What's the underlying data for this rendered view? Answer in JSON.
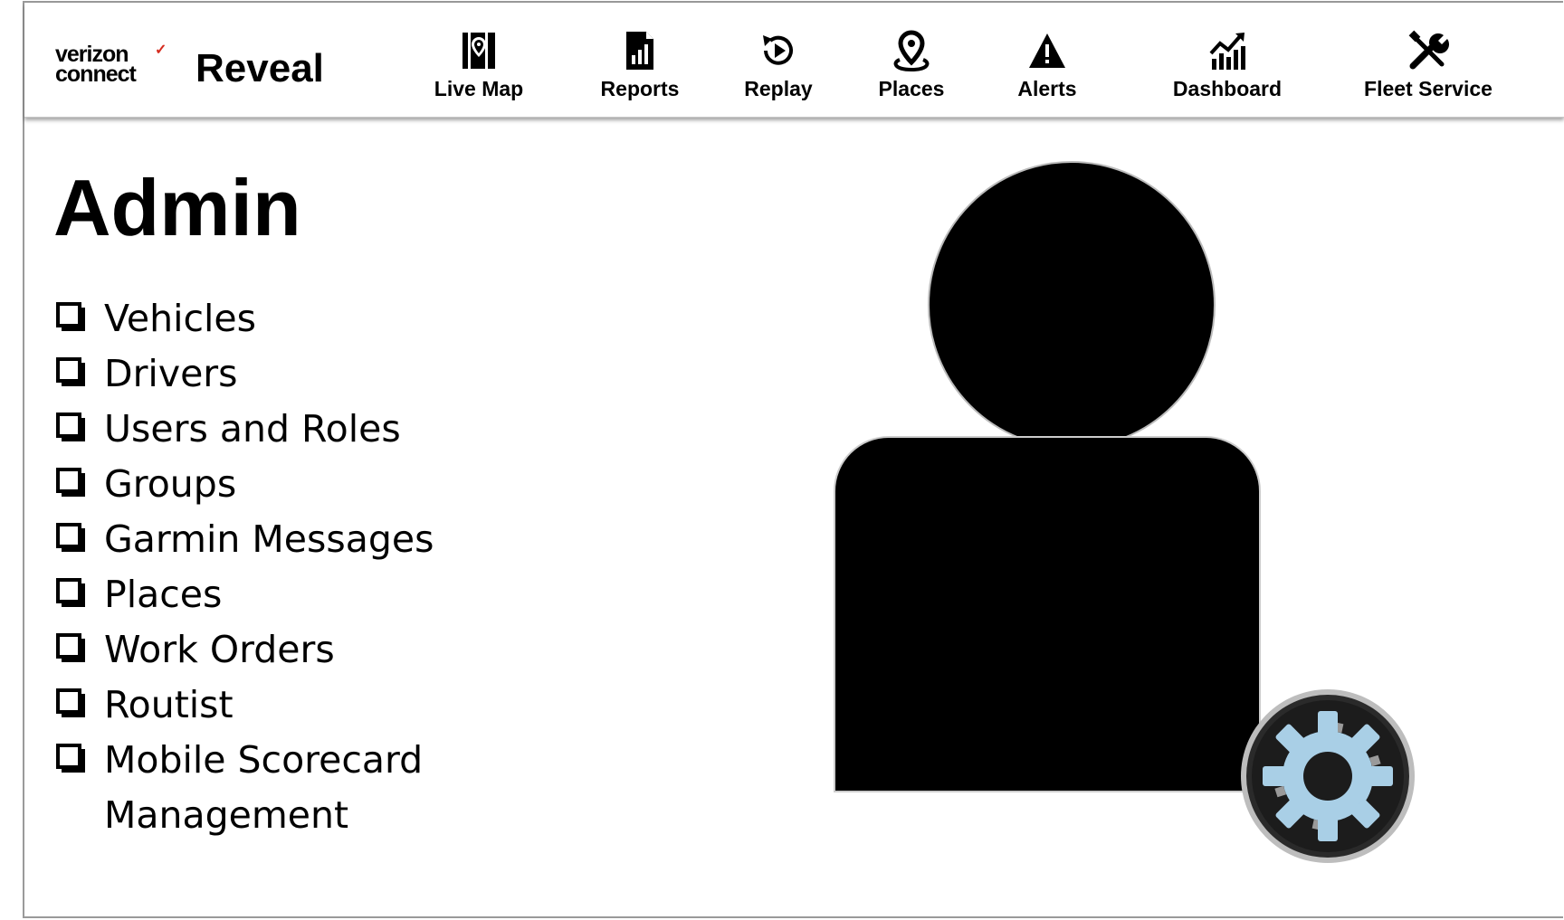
{
  "header": {
    "brand_line1": "verizon",
    "brand_line2": "connect",
    "brand_check": "✓",
    "product": "Reveal",
    "brand_accent_color": "#d52b1e"
  },
  "nav": {
    "items": [
      {
        "label": "Live Map",
        "icon": "map-pin-icon"
      },
      {
        "label": "Reports",
        "icon": "report-icon"
      },
      {
        "label": "Replay",
        "icon": "replay-icon"
      },
      {
        "label": "Places",
        "icon": "place-pin-icon"
      },
      {
        "label": "Alerts",
        "icon": "alert-icon"
      },
      {
        "label": "Dashboard",
        "icon": "dashboard-icon"
      },
      {
        "label": "Fleet Service",
        "icon": "tools-icon"
      }
    ]
  },
  "page": {
    "title": "Admin",
    "menu": [
      "Vehicles",
      "Drivers",
      "Users and Roles",
      "Groups",
      "Garmin Messages",
      "Places",
      "Work Orders",
      "Routist",
      "Mobile Scorecard",
      "Management"
    ]
  },
  "illustration": {
    "icon": "admin-user-gear-icon",
    "gear_color": "#a9cfe6"
  }
}
